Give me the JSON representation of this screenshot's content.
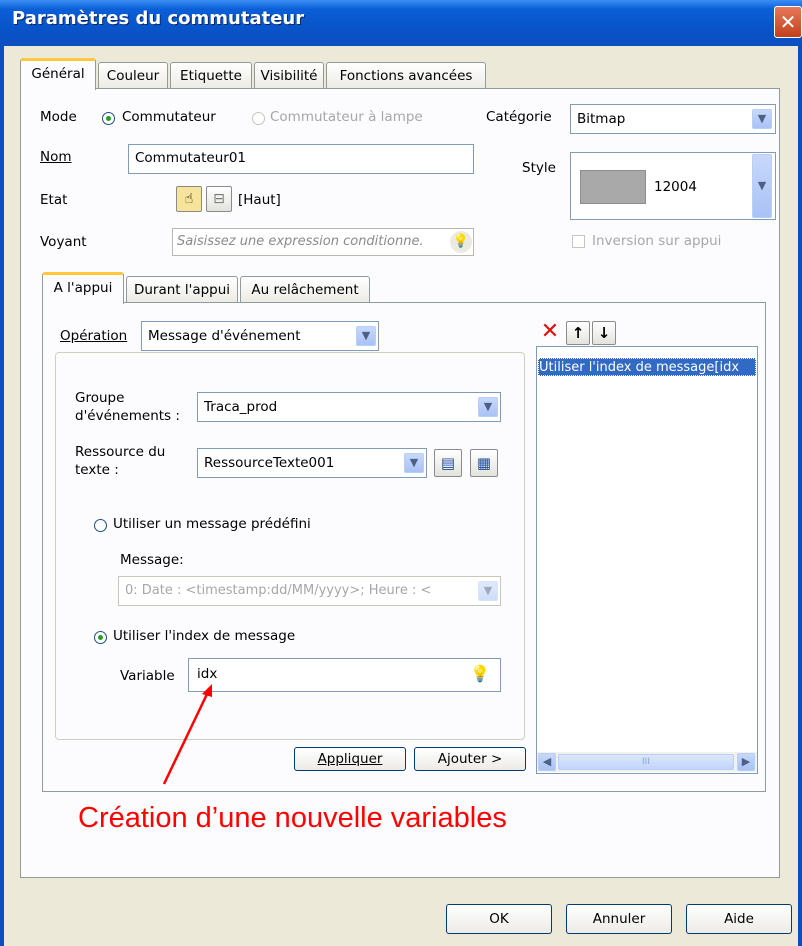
{
  "window": {
    "title": "Paramètres du commutateur",
    "close_symbol": "✕"
  },
  "tabs": [
    "Général",
    "Couleur",
    "Etiquette",
    "Visibilité",
    "Fonctions avancées"
  ],
  "general": {
    "mode_label": "Mode",
    "mode_option1": "Commutateur",
    "mode_option2": "Commutateur à lampe",
    "nom_label": "Nom",
    "nom_value": "Commutateur01",
    "etat_label": "Etat",
    "etat_value": "[Haut]",
    "voyant_label": "Voyant",
    "voyant_placeholder": "Saisissez une expression conditionne.",
    "categorie_label": "Catégorie",
    "categorie_value": "Bitmap",
    "style_label": "Style",
    "style_value": "12004",
    "inversion_label": "Inversion sur appui"
  },
  "subtabs": [
    "A l'appui",
    "Durant l'appui",
    "Au relâchement"
  ],
  "action": {
    "operation_label": "Opération",
    "operation_value": "Message d'événement",
    "groupe_label_1": "Groupe",
    "groupe_label_2": "d'événements :",
    "groupe_value": "Traca_prod",
    "ressource_label_1": "Ressource du",
    "ressource_label_2": "texte :",
    "ressource_value": "RessourceTexte001",
    "radio_predefini": "Utiliser un message prédéfini",
    "message_label": "Message:",
    "message_value": "0: Date : <timestamp:dd/MM/yyyy>; Heure : <",
    "radio_index": "Utiliser l'index de message",
    "variable_label": "Variable",
    "variable_value": "idx",
    "apply_label": "Appliquer",
    "add_label": "Ajouter >"
  },
  "list": {
    "items": [
      "Utiliser l'index de message[idx"
    ],
    "delete_symbol": "✕",
    "up_symbol": "↑",
    "down_symbol": "↓",
    "scroll_grip": "III"
  },
  "annotation": {
    "text": "Création d’une nouvelle variables",
    "color": "#ff0000"
  },
  "footer": {
    "ok_label": "OK",
    "cancel_label": "Annuler",
    "help_label": "Aide"
  },
  "colors": {
    "title_bar": "#0a5fd8",
    "tab_highlight": "#ffc83c",
    "selection": "#316ac5",
    "radio_dot": "#21a121"
  },
  "icons": [
    "close-icon",
    "hand-switch-icon",
    "switch-icon",
    "lightbulb-icon",
    "delete-icon",
    "arrow-up-icon",
    "arrow-down-icon",
    "text-resource-icon",
    "new-resource-icon",
    "dropdown-arrow-icon"
  ]
}
